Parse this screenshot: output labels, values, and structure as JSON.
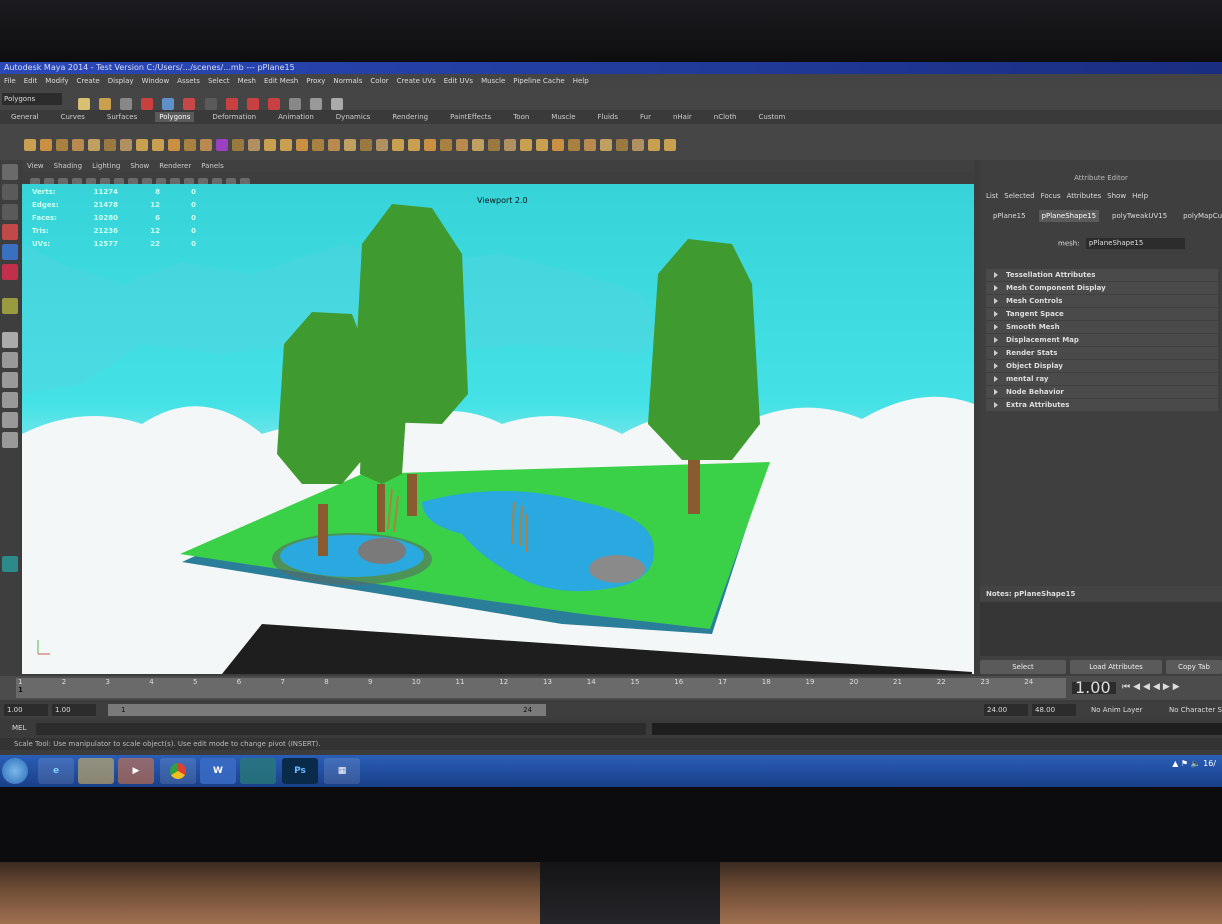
{
  "window": {
    "title": "Autodesk Maya 2014 - Test Version  C:/Users/.../scenes/...mb  ---  pPlane15"
  },
  "menubar": [
    "File",
    "Edit",
    "Modify",
    "Create",
    "Display",
    "Window",
    "Assets",
    "Select",
    "Mesh",
    "Edit Mesh",
    "Proxy",
    "Normals",
    "Color",
    "Create UVs",
    "Edit UVs",
    "Muscle",
    "Pipeline Cache",
    "Help"
  ],
  "mode_selector": "Polygons",
  "shelf_tabs": [
    "General",
    "Curves",
    "Surfaces",
    "Polygons",
    "Deformation",
    "Animation",
    "Dynamics",
    "Rendering",
    "PaintEffects",
    "Toon",
    "Muscle",
    "Fluids",
    "Fur",
    "nHair",
    "nCloth",
    "Custom"
  ],
  "active_shelf": "Polygons",
  "panel_menu": [
    "View",
    "Shading",
    "Lighting",
    "Show",
    "Renderer",
    "Panels"
  ],
  "hud": {
    "rows": [
      {
        "label": "Verts:",
        "v1": "11274",
        "v2": "8",
        "v3": "0"
      },
      {
        "label": "Edges:",
        "v1": "21478",
        "v2": "12",
        "v3": "0"
      },
      {
        "label": "Faces:",
        "v1": "10280",
        "v2": "6",
        "v3": "0"
      },
      {
        "label": "Tris:",
        "v1": "21236",
        "v2": "12",
        "v3": "0"
      },
      {
        "label": "UVs:",
        "v1": "12577",
        "v2": "22",
        "v3": "0"
      }
    ]
  },
  "viewport_label": "Viewport 2.0",
  "attribute_editor": {
    "header": "Attribute Editor",
    "menu": [
      "List",
      "Selected",
      "Focus",
      "Attributes",
      "Show",
      "Help"
    ],
    "tabs": [
      "pPlane15",
      "pPlaneShape15",
      "polyTweakUV15",
      "polyMapCut9"
    ],
    "active_tab": "pPlaneShape15",
    "mesh_label": "mesh:",
    "mesh_value": "pPlaneShape15",
    "sections": [
      "Tessellation Attributes",
      "Mesh Component Display",
      "Mesh Controls",
      "Tangent Space",
      "Smooth Mesh",
      "Displacement Map",
      "Render Stats",
      "Object Display",
      "mental ray",
      "Node Behavior",
      "Extra Attributes"
    ],
    "notes_label": "Notes: pPlaneShape15",
    "buttons": [
      "Select",
      "Load Attributes",
      "Copy Tab"
    ]
  },
  "timeline": {
    "current_frame": "1",
    "ticks": [
      "1",
      "2",
      "3",
      "4",
      "5",
      "6",
      "7",
      "8",
      "9",
      "10",
      "11",
      "12",
      "13",
      "14",
      "15",
      "16",
      "17",
      "18",
      "19",
      "20",
      "21",
      "22",
      "23",
      "24"
    ],
    "current_time_field": "1.00"
  },
  "range_slider": {
    "start": "1.00",
    "start2": "1.00",
    "range_start_marker": "1",
    "range_end_marker": "24",
    "end": "24.00",
    "end2": "48.00",
    "anim_layer": "No Anim Layer",
    "character_set": "No Character Set"
  },
  "command_line": {
    "label": "MEL"
  },
  "help_line": "Scale Tool: Use manipulator to scale object(s). Use edit mode to change pivot (INSERT).",
  "taskbar": {
    "apps": [
      "start-orb",
      "internet-explorer",
      "file-explorer",
      "media-player",
      "chrome",
      "word",
      "maya",
      "photoshop",
      "network"
    ],
    "labels": {
      "word": "W",
      "photoshop": "Ps"
    },
    "clock": "16/"
  }
}
